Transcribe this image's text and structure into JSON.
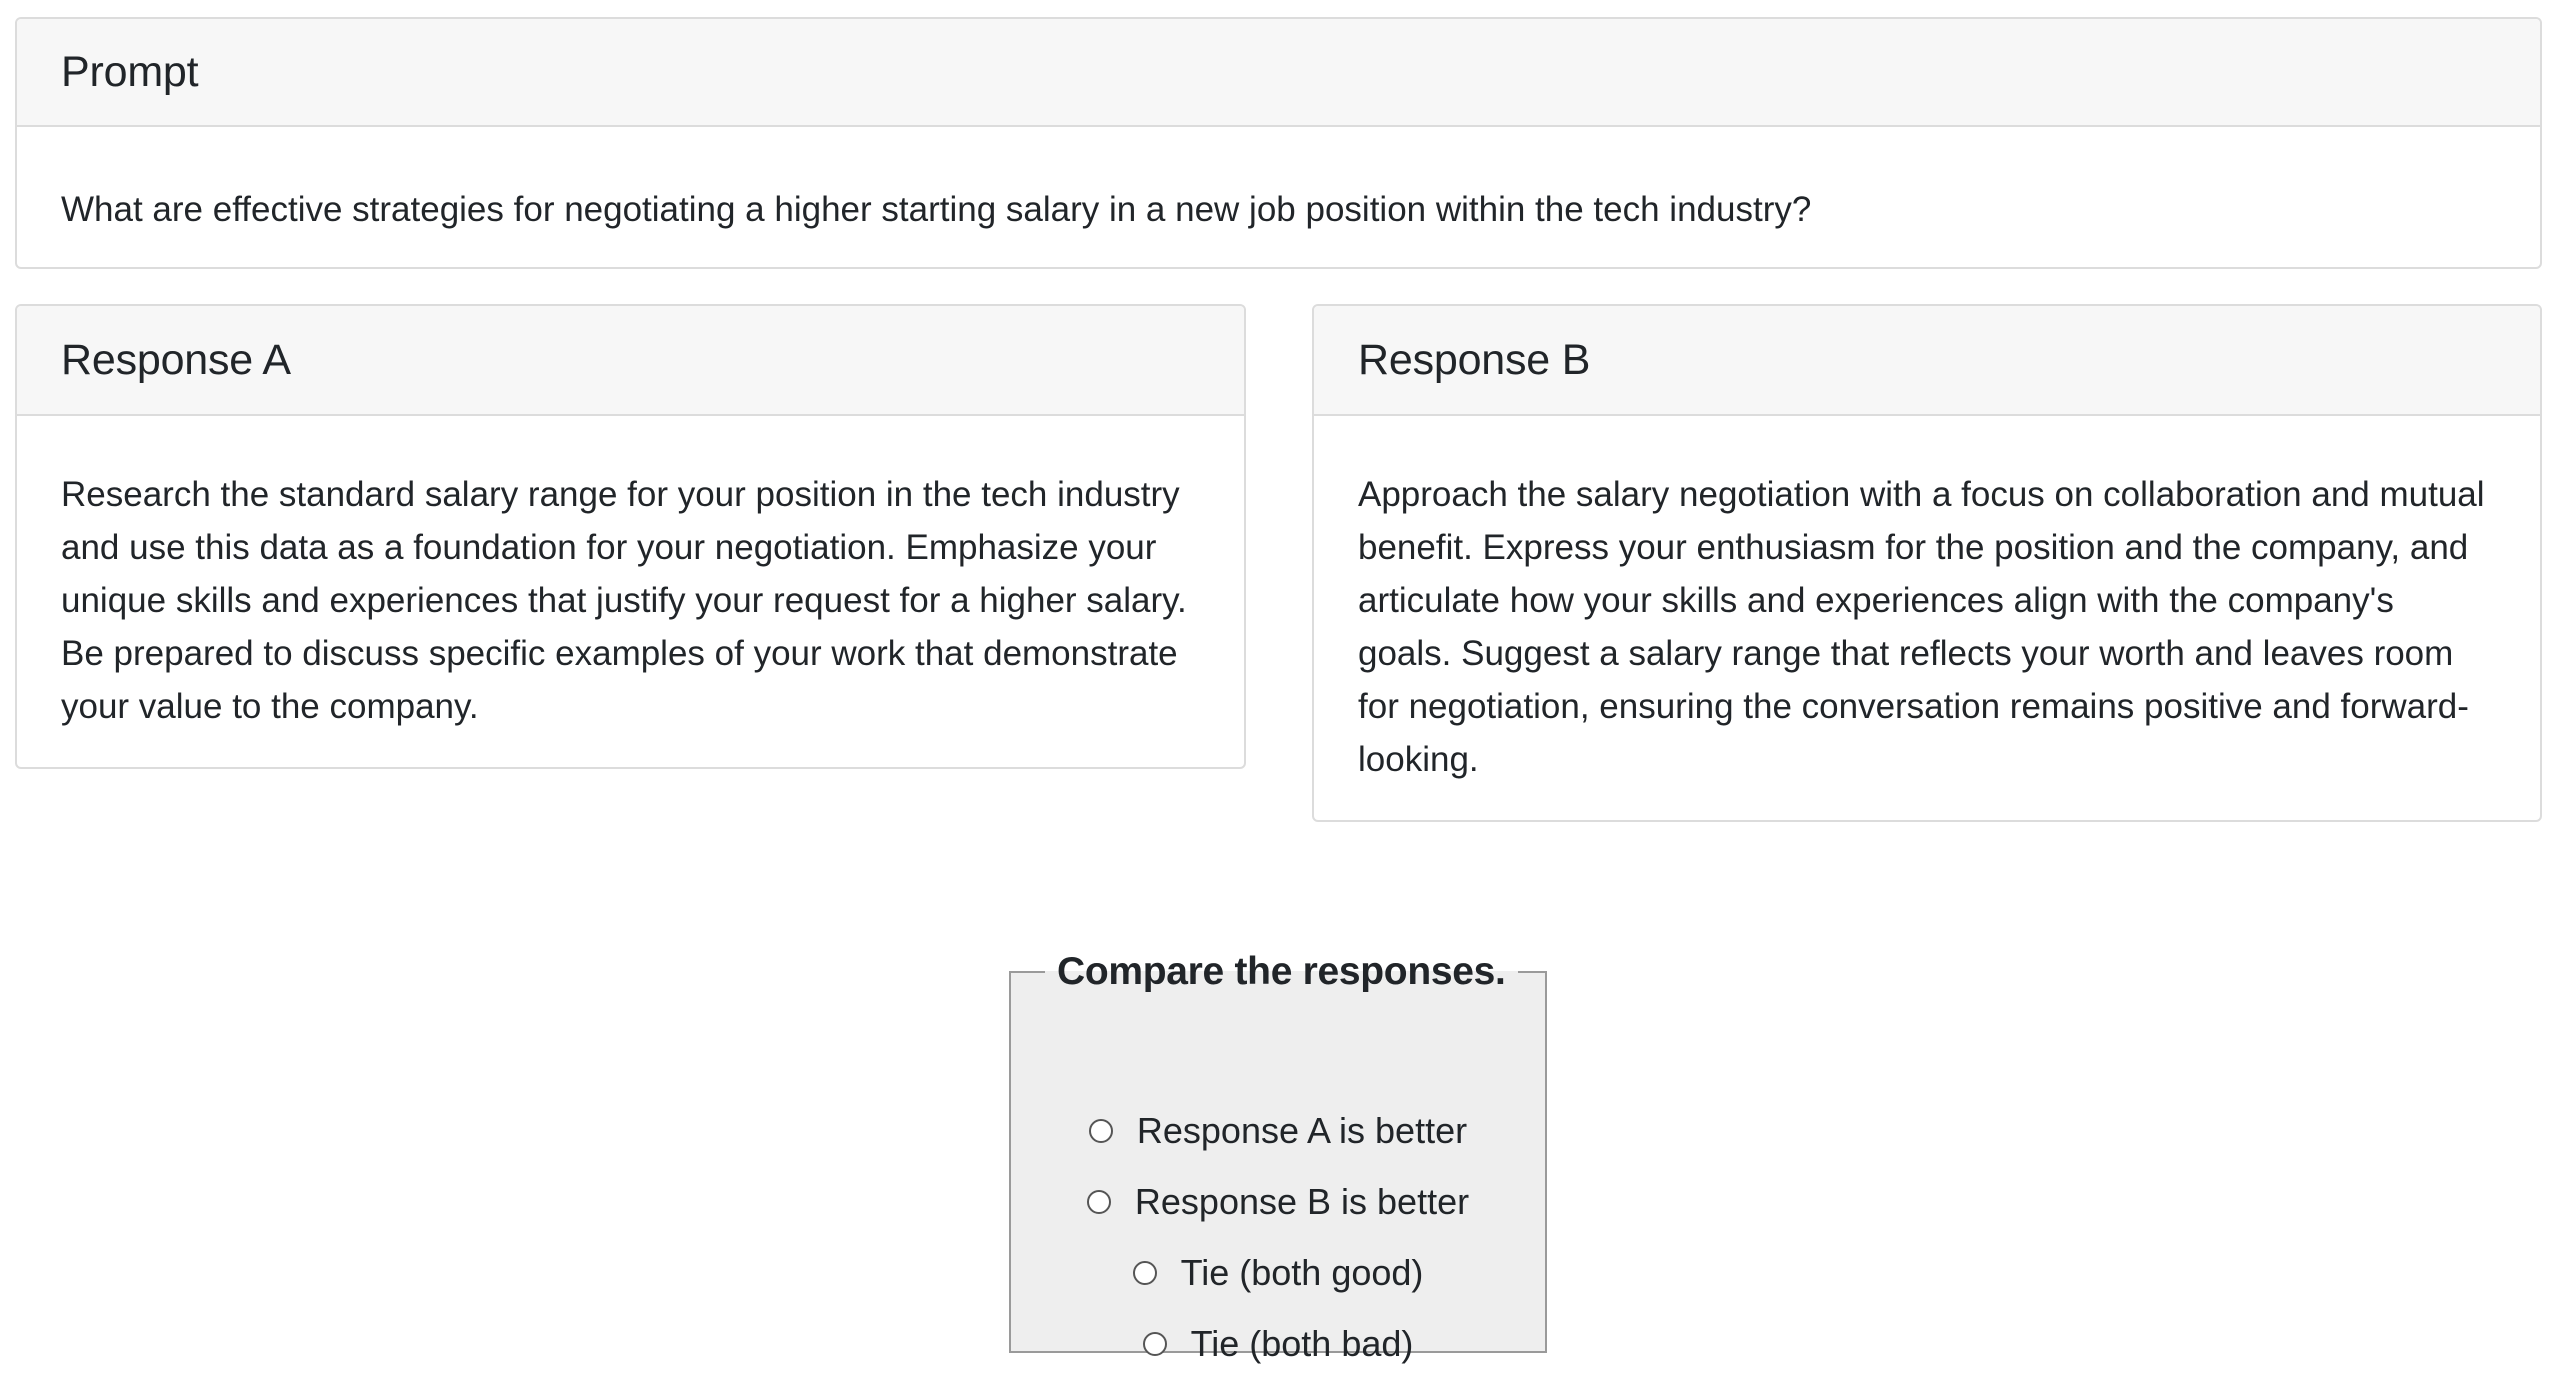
{
  "prompt": {
    "title": "Prompt",
    "text": "What are effective strategies for negotiating a higher starting salary in a new job position within the tech industry?"
  },
  "response_a": {
    "title": "Response A",
    "text": "Research the standard salary range for your position in the tech industry and use this data as a foundation for your negotiation. Emphasize your unique skills and experiences that justify your request for a higher salary. Be prepared to discuss specific examples of your work that demonstrate your value to the company."
  },
  "response_b": {
    "title": "Response B",
    "text": "Approach the salary negotiation with a focus on collaboration and mutual benefit. Express your enthusiasm for the position and the company, and articulate how your skills and experiences align with the company's goals. Suggest a salary range that reflects your worth and leaves room for negotiation, ensuring the conversation remains positive and forward-looking."
  },
  "compare": {
    "legend": "Compare the responses.",
    "options": [
      {
        "label": "Response A is better",
        "checked": false
      },
      {
        "label": "Response B is better",
        "checked": false
      },
      {
        "label": "Tie (both good)",
        "checked": false
      },
      {
        "label": "Tie (both bad)",
        "checked": false
      }
    ]
  }
}
